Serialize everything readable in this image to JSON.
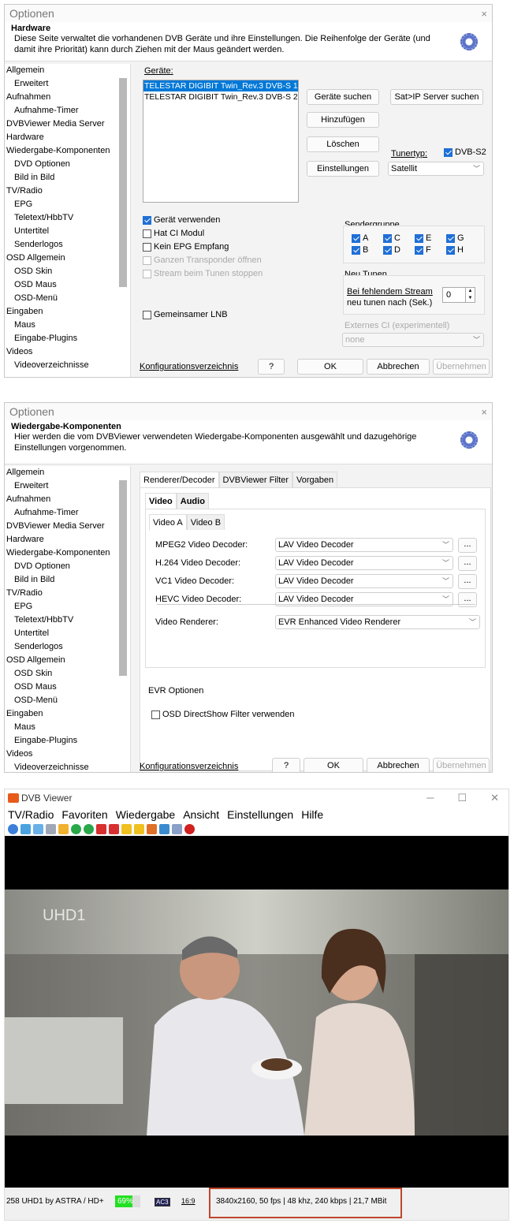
{
  "tree_items": [
    {
      "label": "Allgemein",
      "sub": false
    },
    {
      "label": "Erweitert",
      "sub": true
    },
    {
      "label": "Aufnahmen",
      "sub": false
    },
    {
      "label": "Aufnahme-Timer",
      "sub": true
    },
    {
      "label": "DVBViewer Media Server",
      "sub": false
    },
    {
      "label": "Hardware",
      "sub": false
    },
    {
      "label": "Wiedergabe-Komponenten",
      "sub": false
    },
    {
      "label": "DVD Optionen",
      "sub": true
    },
    {
      "label": "Bild in Bild",
      "sub": true
    },
    {
      "label": "TV/Radio",
      "sub": false
    },
    {
      "label": "EPG",
      "sub": true
    },
    {
      "label": "Teletext/HbbTV",
      "sub": true
    },
    {
      "label": "Untertitel",
      "sub": true
    },
    {
      "label": "Senderlogos",
      "sub": true
    },
    {
      "label": "OSD Allgemein",
      "sub": false
    },
    {
      "label": "OSD Skin",
      "sub": true
    },
    {
      "label": "OSD Maus",
      "sub": true
    },
    {
      "label": "OSD-Menü",
      "sub": true
    },
    {
      "label": "Eingaben",
      "sub": false
    },
    {
      "label": "Maus",
      "sub": true
    },
    {
      "label": "Eingabe-Plugins",
      "sub": true
    },
    {
      "label": "Videos",
      "sub": false
    },
    {
      "label": "Videoverzeichnisse",
      "sub": true
    }
  ],
  "footer": {
    "config_link": "Konfigurationsverzeichnis",
    "help": "?",
    "ok": "OK",
    "cancel": "Abbrechen",
    "apply": "Übernehmen"
  },
  "dialog1": {
    "title": "Optionen",
    "close": "×",
    "heading": "Hardware",
    "description": "Diese Seite verwaltet die vorhandenen DVB Geräte und ihre Einstellungen. Die Reihenfolge der Geräte (und damit ihre Priorität) kann durch Ziehen mit der Maus geändert werden.",
    "devices_label": "Geräte:",
    "devices": [
      "TELESTAR DIGIBIT Twin_Rev.3 DVB-S 1",
      "TELESTAR DIGIBIT Twin_Rev.3 DVB-S 2"
    ],
    "btn_search": "Geräte suchen",
    "btn_satip": "Sat>IP Server suchen",
    "btn_add": "Hinzufügen",
    "btn_delete": "Löschen",
    "btn_settings": "Einstellungen",
    "tunertype_label": "Tunertyp:",
    "tunertype_check": "DVB-S2",
    "tunertype_value": "Satellit",
    "chk_use": "Gerät verwenden",
    "chk_ci": "Hat CI Modul",
    "chk_noepg": "Kein EPG Empfang",
    "chk_transponder": "Ganzen Transponder öffnen",
    "chk_stop": "Stream beim Tunen stoppen",
    "chk_lnb": "Gemeinsamer LNB",
    "sendergruppe_label": "Sendergruppe",
    "groups": [
      "A",
      "C",
      "E",
      "G",
      "B",
      "D",
      "F",
      "H"
    ],
    "neutunen_label": "Neu Tunen",
    "neutunen_text1": "Bei fehlendem Stream",
    "neutunen_text2": "neu tunen nach (Sek.)",
    "neutunen_value": "0",
    "ci_label": "Externes CI (experimentell)",
    "ci_value": "none"
  },
  "dialog2": {
    "title": "Optionen",
    "close": "×",
    "heading": "Wiedergabe-Komponenten",
    "description": "Hier werden die vom DVBViewer verwendeten Wiedergabe-Komponenten ausgewählt und dazugehörige Einstellungen vorgenommen.",
    "tabs": [
      "Renderer/Decoder",
      "DVBViewer Filter",
      "Vorgaben"
    ],
    "subtabs": [
      "Video",
      "Audio"
    ],
    "subsubtabs": [
      "Video A",
      "Video B"
    ],
    "decoders": [
      {
        "label": "MPEG2 Video Decoder:",
        "value": "LAV Video Decoder"
      },
      {
        "label": "H.264 Video Decoder:",
        "value": "LAV Video Decoder"
      },
      {
        "label": "VC1 Video Decoder:",
        "value": "LAV Video Decoder"
      },
      {
        "label": "HEVC Video Decoder:",
        "value": "LAV Video Decoder"
      }
    ],
    "more": "...",
    "renderer_label": "Video Renderer:",
    "renderer_value": "EVR Enhanced Video Renderer",
    "evr_label": "EVR Optionen",
    "evr_chk": "OSD DirectShow Filter verwenden"
  },
  "viewer": {
    "title": "DVB Viewer",
    "controls": [
      "─",
      "☐",
      "✕"
    ],
    "menu": [
      "TV/Radio",
      "Favoriten",
      "Wiedergabe",
      "Ansicht",
      "Einstellungen",
      "Hilfe"
    ],
    "osd_text": "UHD1",
    "status_channel": "258 UHD1 by ASTRA / HD+",
    "status_signal": "69%",
    "signal_level": 0.69,
    "status_ac3": "AC3",
    "status_aspect": "16:9",
    "status_info": "3840x2160, 50 fps | 48 khz, 240 kbps | 21,7 MBit"
  }
}
